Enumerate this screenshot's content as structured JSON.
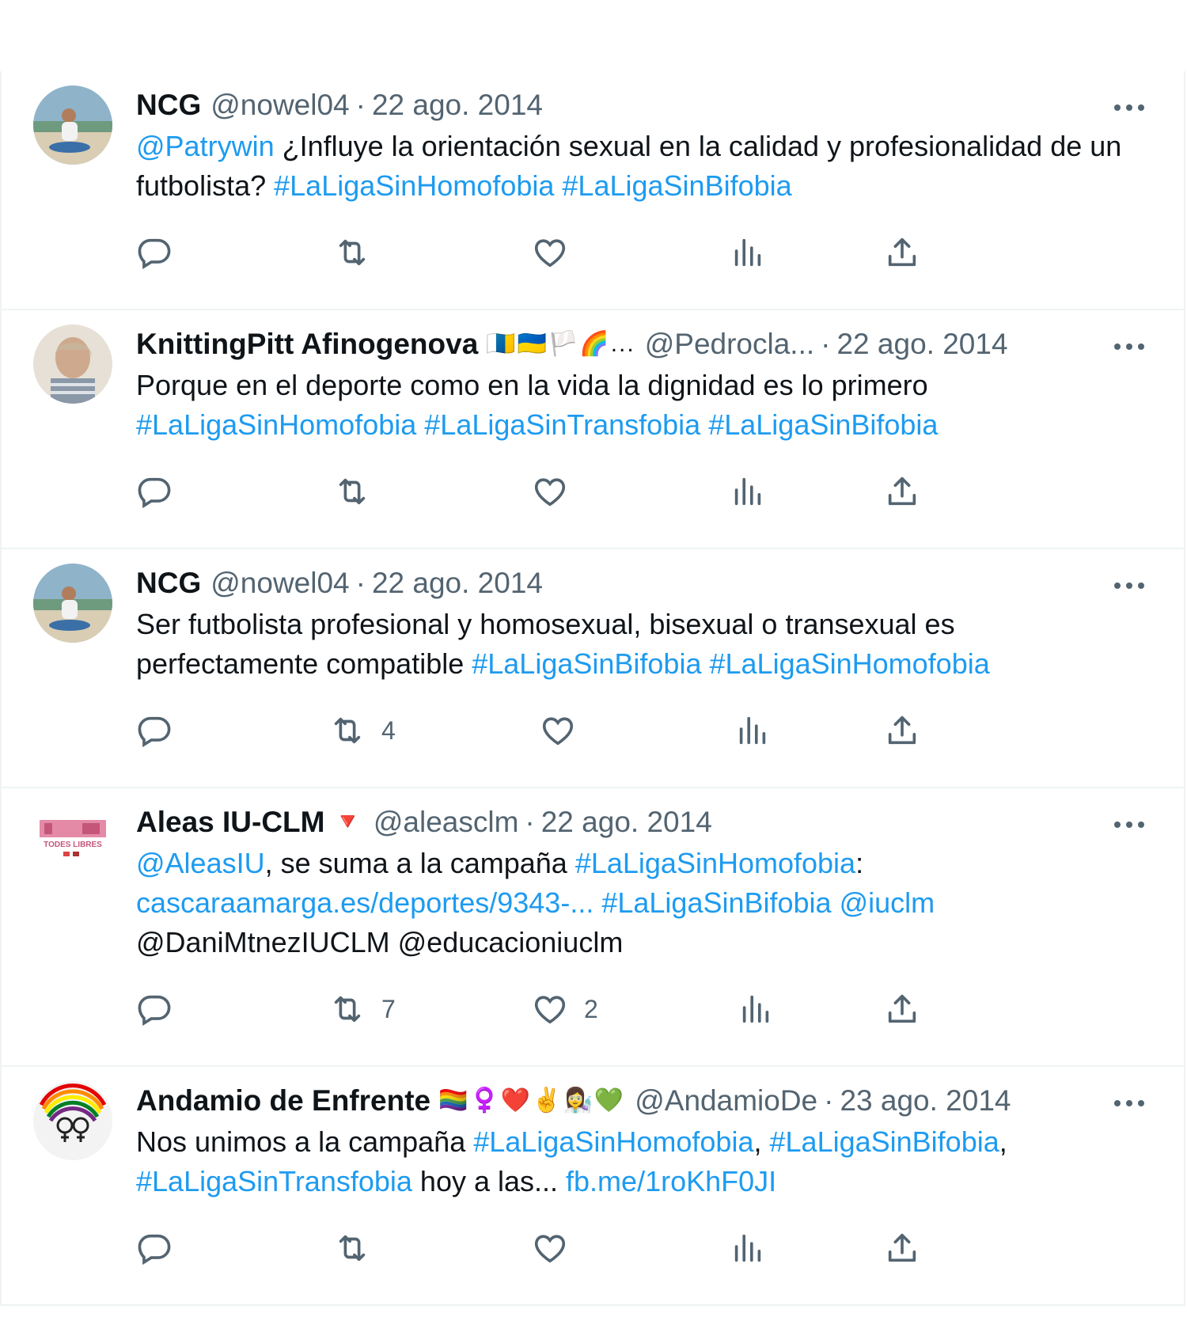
{
  "colors": {
    "link": "#1d9bf0",
    "muted": "#536471",
    "text": "#0f1419",
    "divider": "#eff3f4"
  },
  "tweets": [
    {
      "name": "NCG",
      "handle": "@nowel04",
      "dot": "·",
      "date": "22 ago. 2014",
      "emojis": "",
      "text": [
        {
          "t": "@Patrywin",
          "link": true
        },
        {
          "t": " ¿Influye la orientación sexual en la calidad y profesionalidad de un futbolista? ",
          "link": false
        },
        {
          "t": "#LaLigaSinHomofobia",
          "link": true
        },
        {
          "t": " ",
          "link": false
        },
        {
          "t": "#LaLigaSinBifobia",
          "link": true
        }
      ],
      "reply_count": "",
      "retweet_count": "",
      "like_count": ""
    },
    {
      "name": "KnittingPitt Afinogenova",
      "handle": "@Pedrocla...",
      "dot": "·",
      "date": "22 ago. 2014",
      "emojis": "🇮🇨🇺🇦🏳️🌈...",
      "text": [
        {
          "t": "Porque en el deporte como en la vida la dignidad es lo primero ",
          "link": false
        },
        {
          "t": "#LaLigaSinHomofobia",
          "link": true
        },
        {
          "t": " ",
          "link": false
        },
        {
          "t": "#LaLigaSinTransfobia",
          "link": true
        },
        {
          "t": " ",
          "link": false
        },
        {
          "t": "#LaLigaSinBifobia",
          "link": true
        }
      ],
      "reply_count": "",
      "retweet_count": "",
      "like_count": ""
    },
    {
      "name": "NCG",
      "handle": "@nowel04",
      "dot": "·",
      "date": "22 ago. 2014",
      "emojis": "",
      "text": [
        {
          "t": "Ser futbolista profesional y homosexual, bisexual o transexual es perfectamente compatible ",
          "link": false
        },
        {
          "t": "#LaLigaSinBifobia",
          "link": true
        },
        {
          "t": " ",
          "link": false
        },
        {
          "t": "#LaLigaSinHomofobia",
          "link": true
        }
      ],
      "reply_count": "",
      "retweet_count": "4",
      "like_count": ""
    },
    {
      "name": "Aleas IU-CLM",
      "handle": "@aleasclm",
      "dot": "·",
      "date": "22 ago. 2014",
      "emojis": "🔻",
      "text": [
        {
          "t": "@AleasIU",
          "link": true
        },
        {
          "t": ",  se suma a la campaña ",
          "link": false
        },
        {
          "t": "#LaLigaSinHomofobia",
          "link": true
        },
        {
          "t": ": ",
          "link": false
        },
        {
          "t": "cascaraamarga.es/deportes/9343-...",
          "link": true
        },
        {
          "t": " ",
          "link": false
        },
        {
          "t": "#LaLigaSinBifobia",
          "link": true
        },
        {
          "t": " ",
          "link": false
        },
        {
          "t": "@iuclm",
          "link": true
        },
        {
          "t": " @DaniMtnezIUCLM @educacioniuclm",
          "link": false
        }
      ],
      "reply_count": "",
      "retweet_count": "7",
      "like_count": "2"
    },
    {
      "name": "Andamio de Enfrente",
      "handle": "@AndamioDe",
      "dot": "·",
      "date": "23 ago. 2014",
      "emojis": "🏳️‍🌈♀️❤️✌️👩‍🔬💚",
      "text": [
        {
          "t": "Nos unimos a la campaña ",
          "link": false
        },
        {
          "t": "#LaLigaSinHomofobia",
          "link": true
        },
        {
          "t": ", ",
          "link": false
        },
        {
          "t": "#LaLigaSinBifobia",
          "link": true
        },
        {
          "t": ", ",
          "link": false
        },
        {
          "t": "#LaLigaSinTransfobia",
          "link": true
        },
        {
          "t": " hoy a las... ",
          "link": false
        },
        {
          "t": "fb.me/1roKhF0JI",
          "link": true
        }
      ],
      "reply_count": "",
      "retweet_count": "",
      "like_count": ""
    }
  ]
}
